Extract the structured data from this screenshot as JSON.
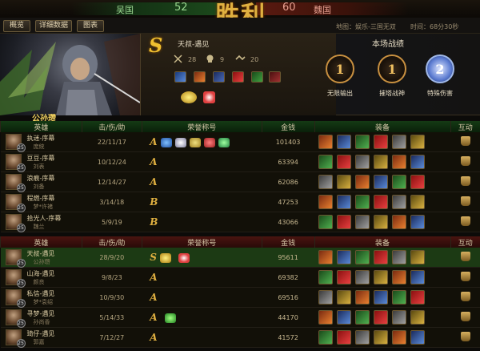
{
  "topbar": {
    "team_left": "吴国",
    "score_left": "52",
    "team_right": "魏国",
    "score_right": "60",
    "result": "胜利"
  },
  "tabs": [
    "概览",
    "详细数据",
    "图表"
  ],
  "map_info": "地图：娱乐-三国无双",
  "time_info": "时间：68分30秒",
  "hero": {
    "name": "公孙瓒",
    "player": "天叔-遇见",
    "grade": "S",
    "stats": [
      "28",
      "9",
      "20"
    ],
    "battle_title": "本场战绩",
    "medals": [
      {
        "num": "1",
        "name": "无限输出"
      },
      {
        "num": "1",
        "name": "摧塔战神"
      },
      {
        "num": "2",
        "name": "特殊伤害"
      }
    ]
  },
  "headers": {
    "hero": "英雄",
    "kda": "击/伤/助",
    "honor": "荣誉称号",
    "gold": "金钱",
    "equip": "装备",
    "interact": "互动"
  },
  "team1": [
    {
      "player": "执迷-序幕",
      "hero": "庞统",
      "level": "25",
      "kda": "22/11/17",
      "grade": "A",
      "gold": "101403"
    },
    {
      "player": "豆豆-序幕",
      "hero": "刘表",
      "level": "25",
      "kda": "10/12/24",
      "grade": "A",
      "gold": "63394"
    },
    {
      "player": "浪痕-序幕",
      "hero": "刘备",
      "level": "25",
      "kda": "12/14/27",
      "grade": "A",
      "gold": "62086"
    },
    {
      "player": "程燃-序幕",
      "hero": "梦*许褚",
      "level": "25",
      "kda": "3/14/18",
      "grade": "B",
      "gold": "47253"
    },
    {
      "player": "拾光人-序幕",
      "hero": "魏兰",
      "level": "25",
      "kda": "5/9/19",
      "grade": "B",
      "gold": "43066"
    }
  ],
  "team2": [
    {
      "player": "天叔-遇见",
      "hero": "公孙瓒",
      "level": "25",
      "kda": "28/9/20",
      "grade": "S",
      "gold": "95611"
    },
    {
      "player": "山海-遇见",
      "hero": "颜良",
      "level": "25",
      "kda": "9/8/23",
      "grade": "A",
      "gold": "69382"
    },
    {
      "player": "私信-遇见",
      "hero": "梦*袁绍",
      "level": "25",
      "kda": "10/9/30",
      "grade": "A",
      "gold": "69516"
    },
    {
      "player": "寻梦-遇见",
      "hero": "孙尚香",
      "level": "25",
      "kda": "5/14/33",
      "grade": "A",
      "gold": "44170"
    },
    {
      "player": "琦仔-遇见",
      "hero": "郭嘉",
      "level": "25",
      "kda": "7/12/27",
      "grade": "A",
      "gold": "41572"
    }
  ],
  "colors": {
    "accent": "#f0c030",
    "team_wu": "#1c4a1c",
    "team_wei": "#5a1a10"
  }
}
